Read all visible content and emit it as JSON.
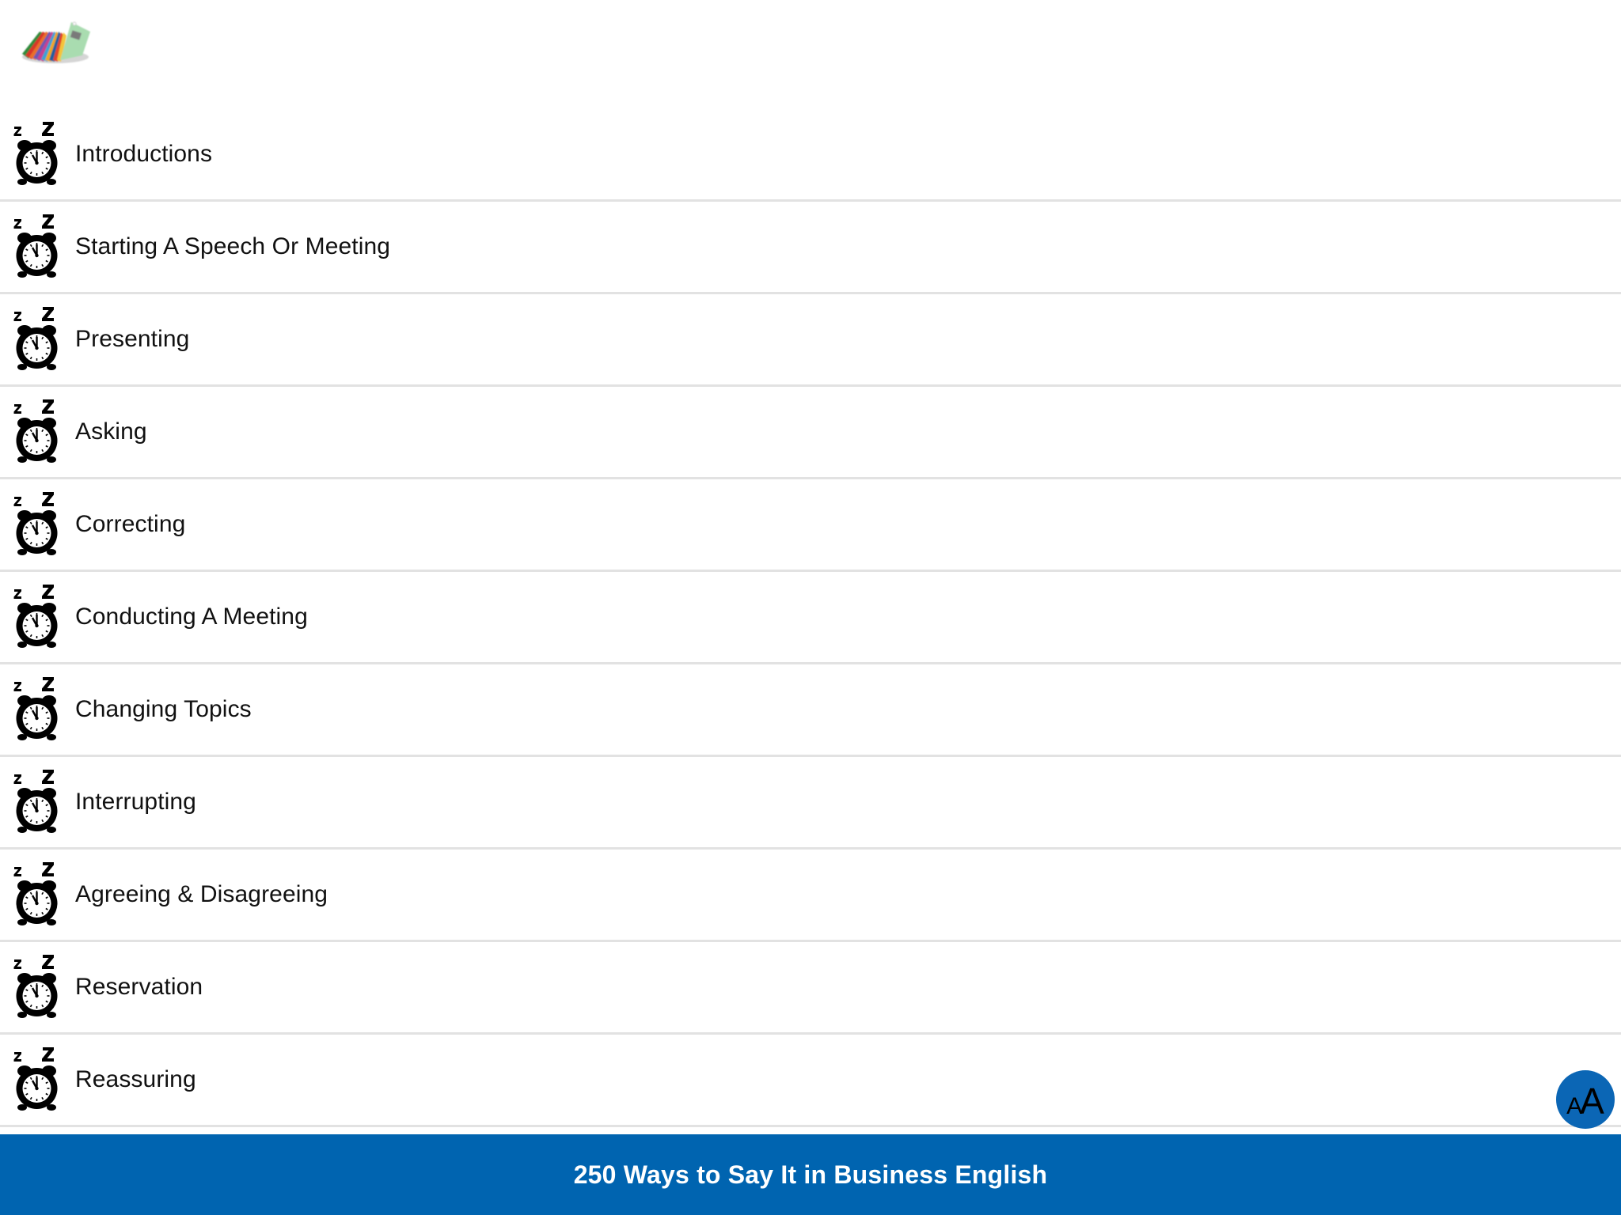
{
  "app": {
    "logo_icon": "flashcards-logo-icon"
  },
  "topics": [
    {
      "label": "Introductions",
      "icon": "sleeping-alarm-clock-icon"
    },
    {
      "label": "Starting A Speech Or Meeting",
      "icon": "sleeping-alarm-clock-icon"
    },
    {
      "label": "Presenting",
      "icon": "sleeping-alarm-clock-icon"
    },
    {
      "label": "Asking",
      "icon": "sleeping-alarm-clock-icon"
    },
    {
      "label": "Correcting",
      "icon": "sleeping-alarm-clock-icon"
    },
    {
      "label": "Conducting A Meeting",
      "icon": "sleeping-alarm-clock-icon"
    },
    {
      "label": "Changing Topics",
      "icon": "sleeping-alarm-clock-icon"
    },
    {
      "label": "Interrupting",
      "icon": "sleeping-alarm-clock-icon"
    },
    {
      "label": "Agreeing & Disagreeing",
      "icon": "sleeping-alarm-clock-icon"
    },
    {
      "label": "Reservation",
      "icon": "sleeping-alarm-clock-icon"
    },
    {
      "label": "Reassuring",
      "icon": "sleeping-alarm-clock-icon"
    }
  ],
  "font_size_button": {
    "small_glyph": "A",
    "big_glyph": "A",
    "icon": "font-size-icon"
  },
  "footer": {
    "title": "250 Ways to Say It in Business English"
  },
  "colors": {
    "brand_blue": "#0064b0",
    "font_button_blue": "#0b66b5",
    "divider": "#e2e2e2",
    "text": "#111111"
  }
}
